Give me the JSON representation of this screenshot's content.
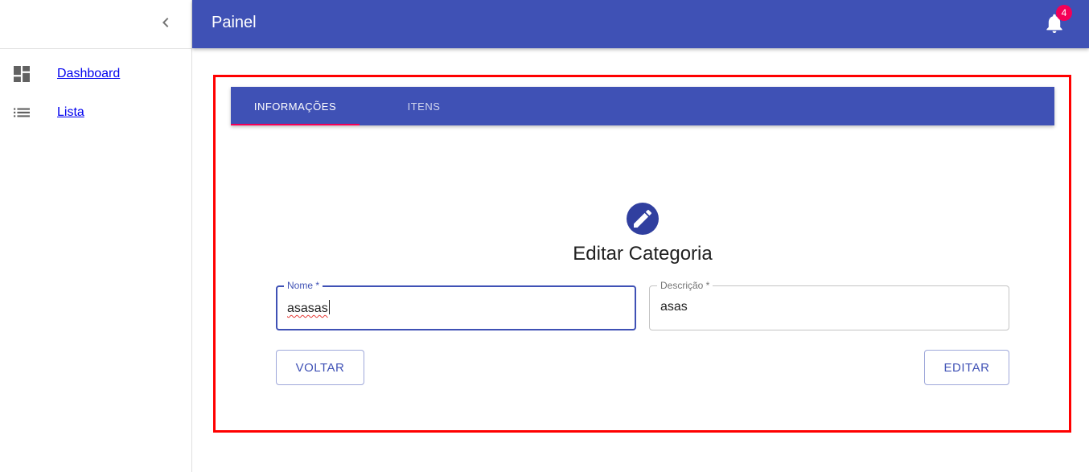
{
  "appbar": {
    "title": "Painel",
    "notification_count": "4"
  },
  "sidebar": {
    "items": [
      {
        "label": "Dashboard",
        "icon": "dashboard-icon"
      },
      {
        "label": "Lista",
        "icon": "list-icon"
      }
    ]
  },
  "tabs": [
    {
      "label": "INFORMAÇÕES",
      "active": true
    },
    {
      "label": "ITENS",
      "active": false
    }
  ],
  "form": {
    "title": "Editar Categoria",
    "nome": {
      "label": "Nome *",
      "value": "asasas"
    },
    "descricao": {
      "label": "Descrição *",
      "value": "asas"
    },
    "back_label": "VOLTAR",
    "submit_label": "EDITAR"
  },
  "colors": {
    "primary": "#3f51b5",
    "primary_dark": "#303f9f",
    "secondary": "#f50057",
    "highlight": "#ff0000"
  }
}
